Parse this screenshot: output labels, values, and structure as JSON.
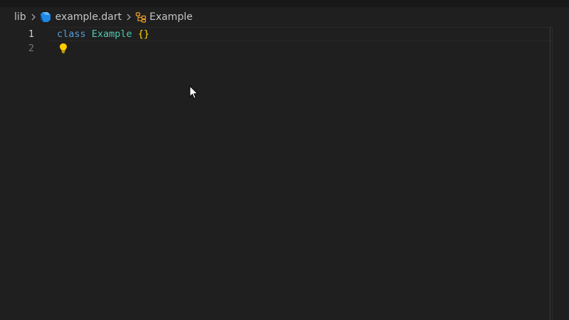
{
  "breadcrumb": {
    "folder": "lib",
    "file": "example.dart",
    "symbol": "Example"
  },
  "editor": {
    "lines": [
      {
        "number": "1",
        "keyword": "class",
        "class_name": "Example",
        "braces": "{}"
      },
      {
        "number": "2"
      }
    ]
  },
  "colors": {
    "keyword": "#569cd6",
    "class_name": "#4ec9b0",
    "braces": "#ffd700",
    "dart_icon": "#1e88e5",
    "symbol_icon": "#ee9d28",
    "lightbulb": "#ffcc00"
  },
  "icons": {
    "file": "dart-file-icon",
    "symbol": "class-symbol-icon",
    "separator": "chevron-right-icon",
    "hint": "lightbulb-icon",
    "pointer": "mouse-cursor-icon"
  }
}
